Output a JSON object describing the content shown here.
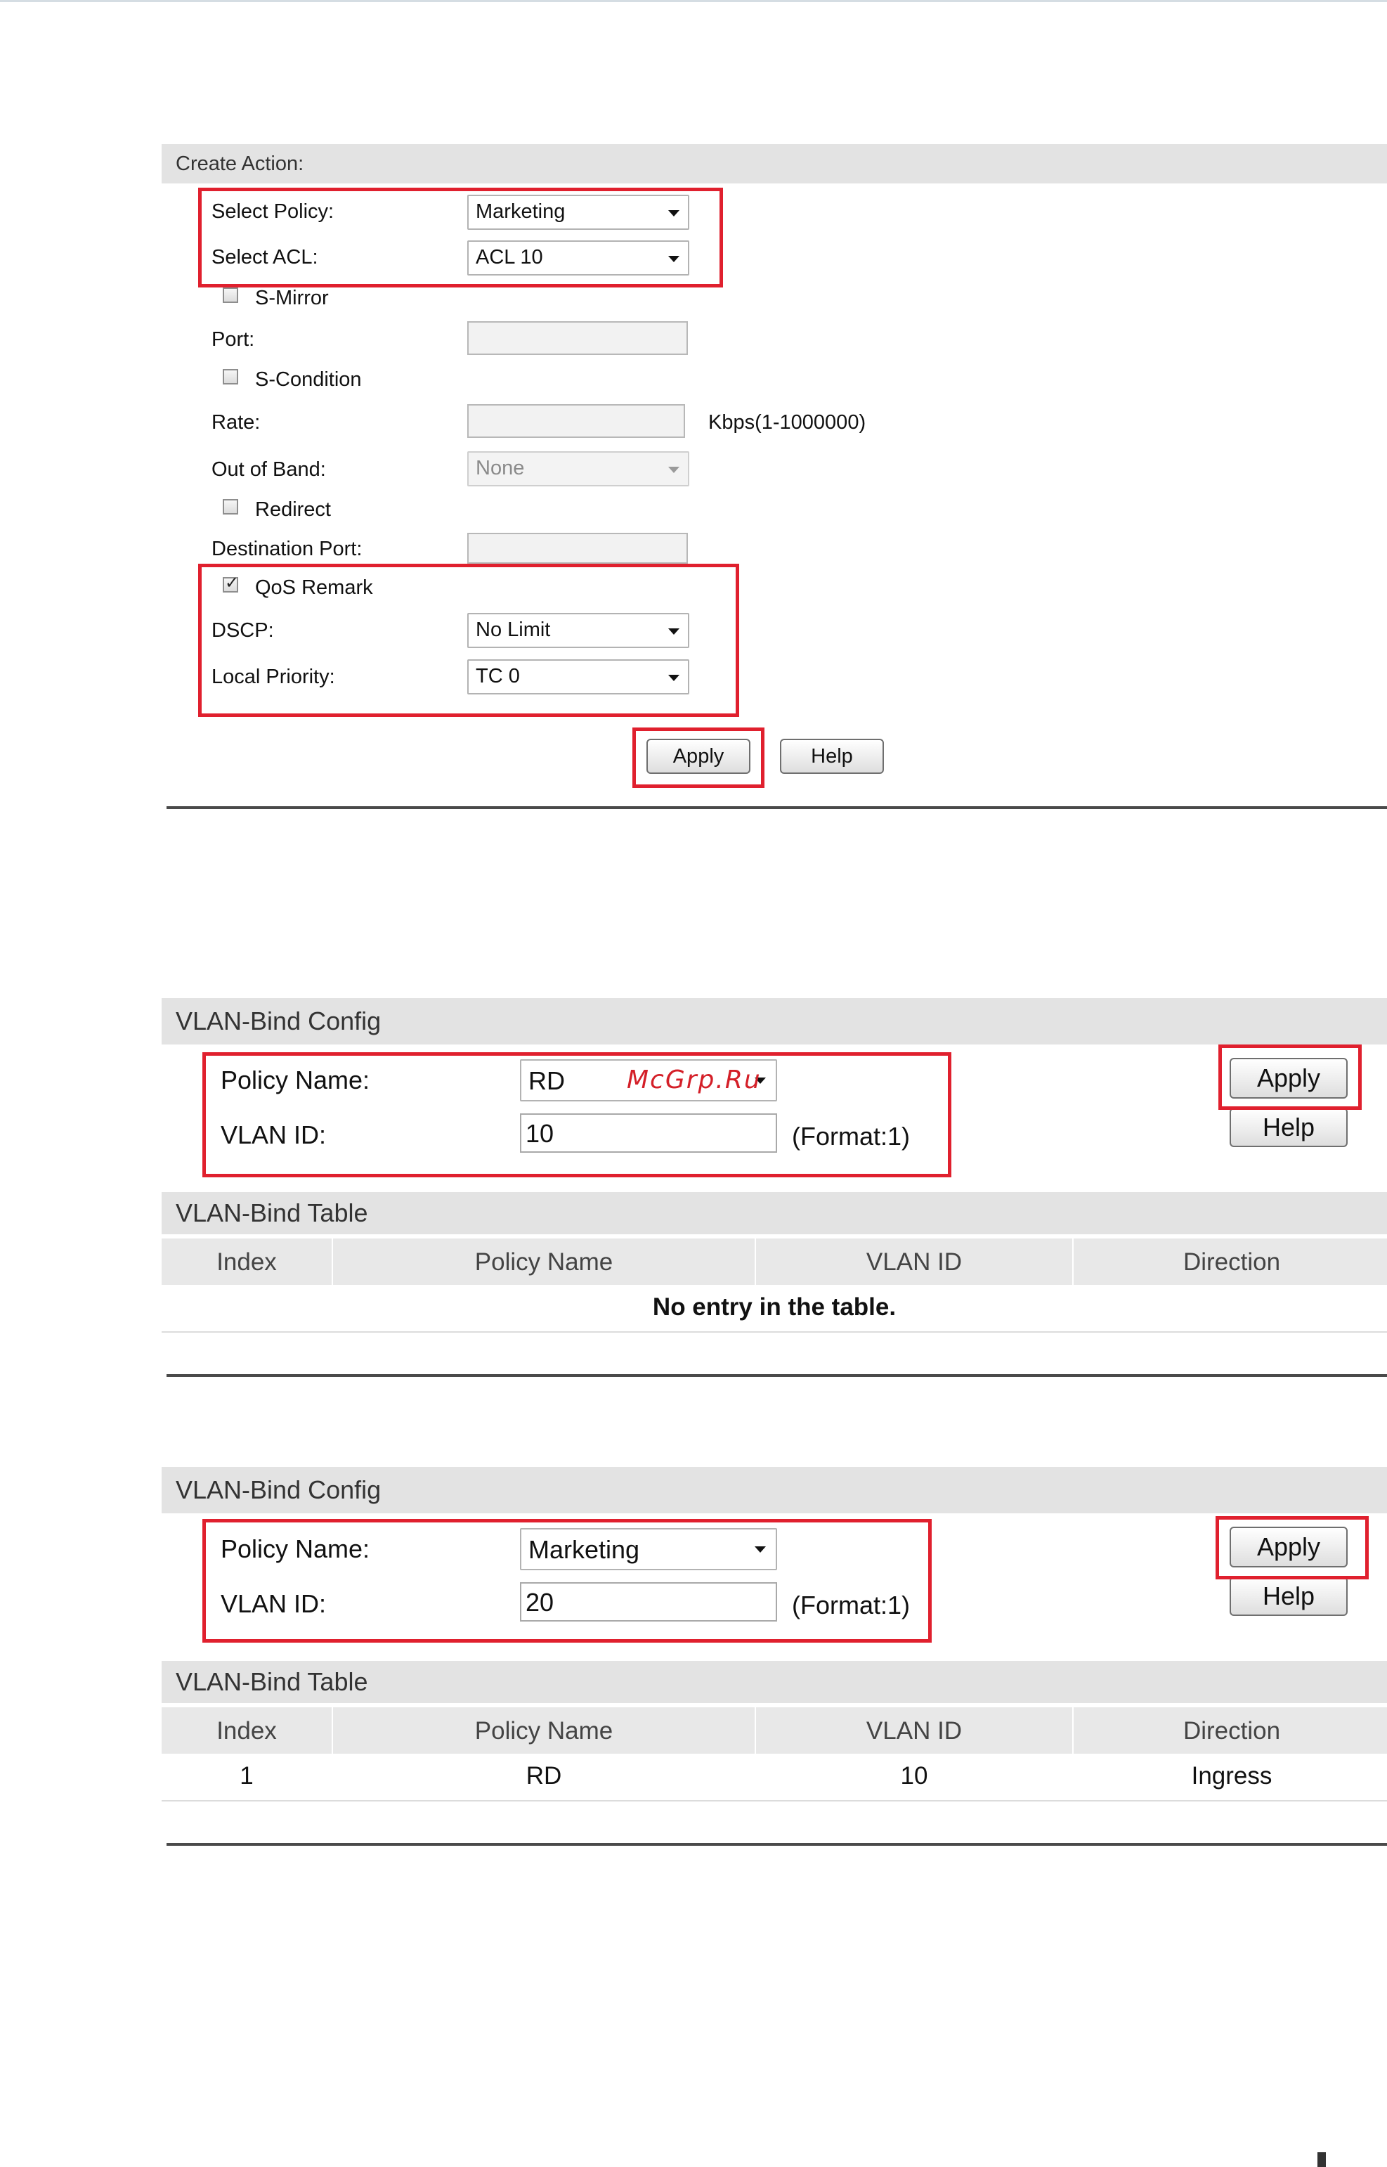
{
  "create_action": {
    "header": "Create Action:",
    "select_policy_label": "Select Policy:",
    "select_policy_value": "Marketing",
    "select_acl_label": "Select ACL:",
    "select_acl_value": "ACL 10",
    "s_mirror_label": "S-Mirror",
    "port_label": "Port:",
    "s_condition_label": "S-Condition",
    "rate_label": "Rate:",
    "rate_hint": "Kbps(1-1000000)",
    "out_of_band_label": "Out of Band:",
    "out_of_band_value": "None",
    "redirect_label": "Redirect",
    "destination_port_label": "Destination Port:",
    "qos_remark_label": "QoS Remark",
    "qos_remark_checked": true,
    "dscp_label": "DSCP:",
    "dscp_value": "No Limit",
    "local_priority_label": "Local Priority:",
    "local_priority_value": "TC 0",
    "apply_label": "Apply",
    "help_label": "Help"
  },
  "vlan_bind_1": {
    "config_header": "VLAN-Bind Config",
    "policy_name_label": "Policy Name:",
    "policy_name_value": "RD",
    "vlan_id_label": "VLAN ID:",
    "vlan_id_value": "10",
    "format_hint": "(Format:1)",
    "apply_label": "Apply",
    "help_label": "Help",
    "table_header": "VLAN-Bind Table",
    "columns": [
      "Index",
      "Policy Name",
      "VLAN ID",
      "Direction"
    ],
    "empty_message": "No entry in the table."
  },
  "vlan_bind_2": {
    "config_header": "VLAN-Bind Config",
    "policy_name_label": "Policy Name:",
    "policy_name_value": "Marketing",
    "vlan_id_label": "VLAN ID:",
    "vlan_id_value": "20",
    "format_hint": "(Format:1)",
    "apply_label": "Apply",
    "help_label": "Help",
    "table_header": "VLAN-Bind Table",
    "columns": [
      "Index",
      "Policy Name",
      "VLAN ID",
      "Direction"
    ],
    "rows": [
      {
        "index": "1",
        "policy_name": "RD",
        "vlan_id": "10",
        "direction": "Ingress"
      }
    ]
  },
  "watermark": "McGrp.Ru",
  "colors": {
    "highlight": "#e0202e",
    "header_bg": "#e3e3e3"
  }
}
